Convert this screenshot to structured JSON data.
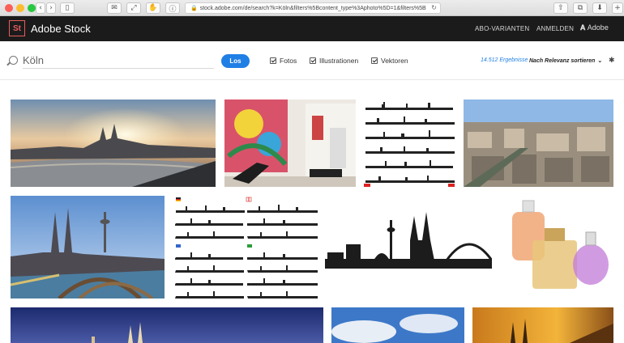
{
  "browser": {
    "url": "stock.adobe.com/de/search?k=Köln&filters%5Bcontent_type%3Aphoto%5D=1&filters%5B",
    "lock_glyph": "🔒",
    "reload_glyph": "↻"
  },
  "header": {
    "logo_mark": "St",
    "brand": "Adobe Stock",
    "nav": {
      "plans": "ABO-VARIANTEN",
      "signin": "ANMELDEN",
      "adobe": "Adobe"
    },
    "colors": {
      "background": "#1b1b1b",
      "logo": "#e85c5c"
    }
  },
  "search": {
    "query": "Köln",
    "button_label": "Los",
    "filters": [
      {
        "label": "Fotos",
        "checked": true
      },
      {
        "label": "Illustrationen",
        "checked": true
      },
      {
        "label": "Vektoren",
        "checked": true
      }
    ],
    "results_count": "14.512 Ergebnisse",
    "sort_label": "Nach Relevanz sortieren",
    "accent_color": "#1f7fe5"
  },
  "gallery": [
    {
      "name": "cologne-sunset-panorama",
      "kind": "photo"
    },
    {
      "name": "colorful-art-interior",
      "kind": "photo"
    },
    {
      "name": "city-skylines-set-1",
      "kind": "vector"
    },
    {
      "name": "cologne-aerial-rooftops",
      "kind": "photo"
    },
    {
      "name": "cologne-cathedral-bridge",
      "kind": "photo"
    },
    {
      "name": "city-skylines-set-2",
      "kind": "vector"
    },
    {
      "name": "cologne-skyline-silhouette",
      "kind": "vector"
    },
    {
      "name": "perfume-bottles",
      "kind": "photo"
    },
    {
      "name": "cathedral-night",
      "kind": "photo"
    },
    {
      "name": "blue-sky-clouds",
      "kind": "photo"
    },
    {
      "name": "cathedral-golden-sunset",
      "kind": "photo"
    }
  ]
}
